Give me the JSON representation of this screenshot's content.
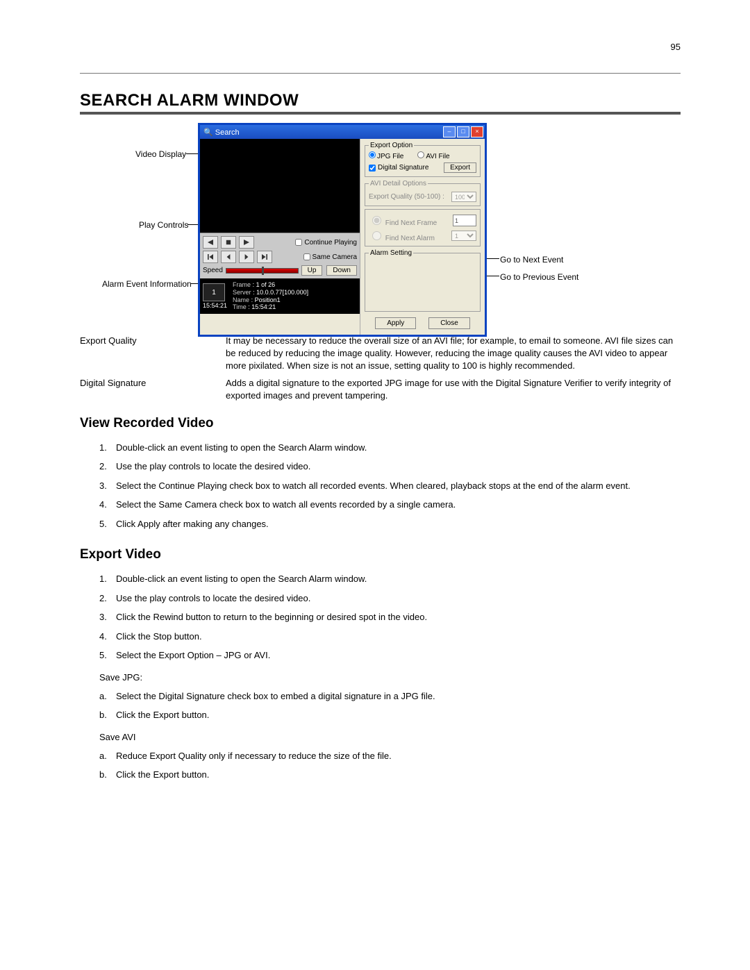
{
  "page_number": "95",
  "main_heading": "SEARCH ALARM WINDOW",
  "callouts": {
    "video_display": "Video Display",
    "play_controls": "Play Controls",
    "alarm_event_info": "Alarm Event Information",
    "go_next": "Go to Next Event",
    "go_prev": "Go to Previous Event"
  },
  "window": {
    "title": "Search",
    "continue_playing": "Continue Playing",
    "same_camera": "Same Camera",
    "speed_label": "Speed",
    "up": "Up",
    "down": "Down",
    "alarm_thumb_num": "1",
    "alarm_time": "15:54:21",
    "info": {
      "frame_l": "Frame",
      "frame_v": "1 of 26",
      "server_l": "Server",
      "server_v": "10.0.0.77[100.000]",
      "name_l": "Name",
      "name_v": "Position1",
      "time_l": "Time",
      "time_v": "15:54:21"
    },
    "export_option_legend": "Export Option",
    "jpg_file": "JPG File",
    "avi_file": "AVI File",
    "digital_signature": "Digital Signature",
    "export_btn": "Export",
    "avi_legend": "AVI Detail Options",
    "export_quality_lbl": "Export Quality (50-100) :",
    "export_quality_val": "100",
    "find_next_frame": "Find Next Frame",
    "find_next_alarm": "Find Next Alarm",
    "fnf_val": "1",
    "fna_val": "1",
    "alarm_setting_legend": "Alarm Setting",
    "apply": "Apply",
    "close": "Close"
  },
  "defs": {
    "export_quality_term": "Export Quality",
    "export_quality_desc": "It may be necessary to reduce the overall size of an AVI file; for example, to email to someone. AVI file sizes can be reduced by reducing the image quality.  However, reducing the image quality causes the AVI video to appear more pixilated.  When size is not an issue, setting quality to 100 is highly recommended.",
    "digital_signature_term": "Digital Signature",
    "digital_signature_desc": "Adds a digital signature to the exported JPG image for use with the Digital Signature Verifier to verify integrity of exported images and prevent tampering."
  },
  "view_heading": "View Recorded Video",
  "view_steps": [
    "Double-click an event listing to open the Search Alarm window.",
    "Use the play controls to locate the desired video.",
    "Select the Continue Playing check box to watch all recorded events.  When cleared, playback stops at the end of the alarm event.",
    "Select the Same Camera check box to watch all events recorded by a single camera.",
    "Click Apply after making any changes."
  ],
  "export_heading": "Export Video",
  "export_steps": [
    "Double-click an event listing to open the Search Alarm window.",
    "Use the play controls to locate the desired video.",
    "Click the Rewind button to return to the beginning or desired spot in the video.",
    "Click the Stop button.",
    "Select the Export Option – JPG or AVI."
  ],
  "save_jpg_label": "Save JPG:",
  "save_jpg_steps": [
    "Select the Digital Signature check box to embed a digital signature in a JPG file.",
    "Click the Export button."
  ],
  "save_avi_label": "Save AVI",
  "save_avi_steps": [
    "Reduce Export Quality only if necessary to reduce the size of the file.",
    "Click the Export button."
  ]
}
